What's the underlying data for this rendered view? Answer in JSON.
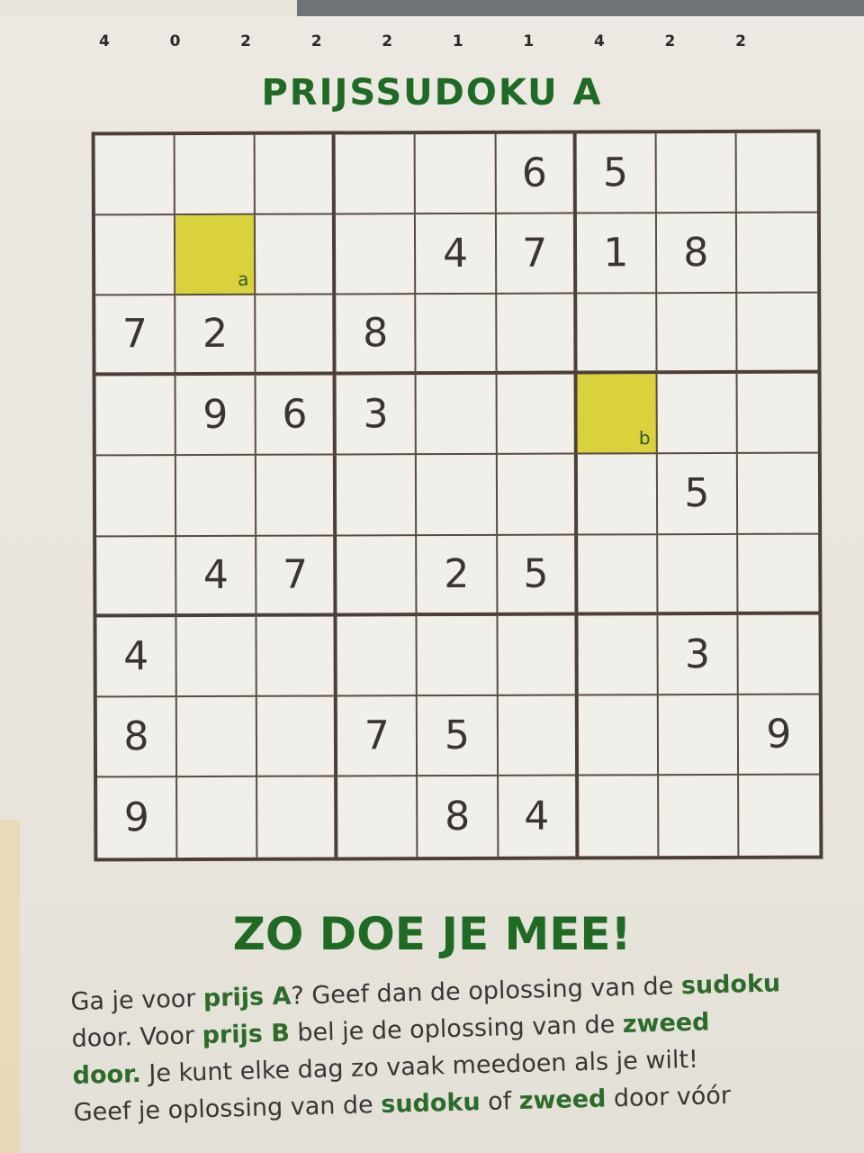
{
  "top_digits": [
    "4",
    "0",
    "2",
    "2",
    "2",
    "1",
    "1",
    "4",
    "2",
    "2"
  ],
  "titles": {
    "puzzle": "PRIJSSUDOKU A",
    "how_to": "ZO DOE JE MEE!"
  },
  "grid": [
    [
      "",
      "",
      "",
      "",
      "",
      "6",
      "5",
      "",
      ""
    ],
    [
      "",
      "",
      "",
      "",
      "4",
      "7",
      "1",
      "8",
      ""
    ],
    [
      "7",
      "2",
      "",
      "8",
      "",
      "",
      "",
      "",
      ""
    ],
    [
      "",
      "9",
      "6",
      "3",
      "",
      "",
      "",
      "",
      ""
    ],
    [
      "",
      "",
      "",
      "",
      "",
      "",
      "",
      "5",
      ""
    ],
    [
      "",
      "4",
      "7",
      "",
      "2",
      "5",
      "",
      "",
      ""
    ],
    [
      "4",
      "",
      "",
      "",
      "",
      "",
      "",
      "3",
      ""
    ],
    [
      "8",
      "",
      "",
      "7",
      "5",
      "",
      "",
      "",
      "9"
    ],
    [
      "9",
      "",
      "",
      "",
      "8",
      "4",
      "",
      "",
      ""
    ]
  ],
  "highlights": [
    {
      "row": 1,
      "col": 1,
      "label": "a"
    },
    {
      "row": 3,
      "col": 6,
      "label": "b"
    }
  ],
  "colors": {
    "accent_green": "#1f6a24",
    "highlight_yellow": "#d9d23c",
    "grid_border": "#4d3f37"
  },
  "instructions": [
    [
      {
        "t": "Ga je voor "
      },
      {
        "t": "prijs A",
        "b": true
      },
      {
        "t": "? Geef dan de oplossing van de "
      },
      {
        "t": "sudoku",
        "b": true
      }
    ],
    [
      {
        "t": "door. Voor "
      },
      {
        "t": "prijs B",
        "b": true
      },
      {
        "t": " bel je de oplossing van de "
      },
      {
        "t": "zweed",
        "b": true
      }
    ],
    [
      {
        "t": "door.",
        "b": true
      },
      {
        "t": " Je kunt elke dag zo vaak meedoen als je wilt!"
      }
    ],
    [
      {
        "t": "Geef je oplossing van de "
      },
      {
        "t": "sudoku",
        "b": true
      },
      {
        "t": " of "
      },
      {
        "t": "zweed",
        "b": true
      },
      {
        "t": " door vóór"
      }
    ]
  ]
}
